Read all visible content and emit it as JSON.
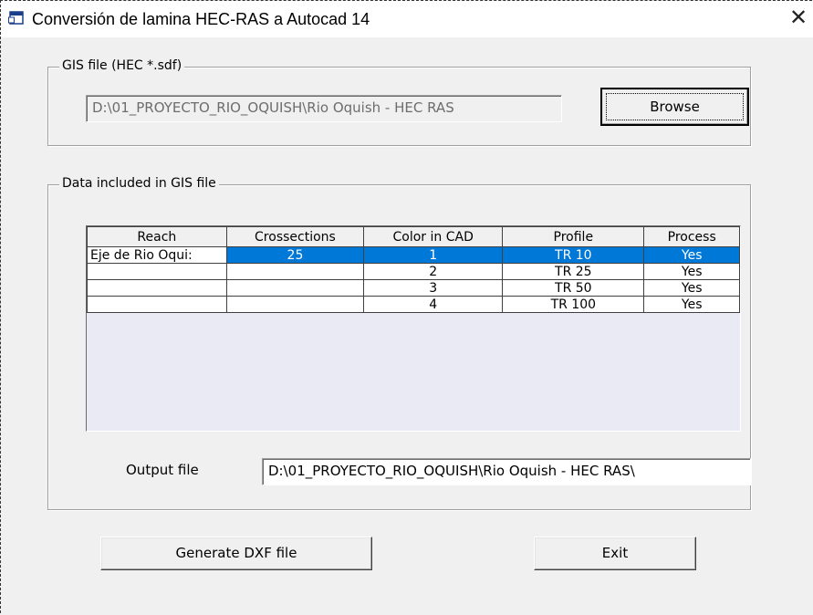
{
  "window": {
    "title": "Conversión de lamina HEC-RAS a Autocad 14",
    "close_glyph": "✕"
  },
  "gis_group": {
    "legend": "GIS file (HEC *.sdf)",
    "path_value": "D:\\01_PROYECTO_RIO_OQUISH\\Rio Oquish - HEC RAS",
    "browse_label": "Browse"
  },
  "data_group": {
    "legend": "Data included in GIS file",
    "columns": [
      "Reach",
      "Crossections",
      "Color in CAD",
      "Profile",
      "Process"
    ],
    "rows": [
      {
        "reach": "Eje de Rio Oqui:",
        "crossections": "25",
        "color": "1",
        "profile": "TR 10",
        "process": "Yes"
      },
      {
        "reach": "",
        "crossections": "",
        "color": "2",
        "profile": "TR 25",
        "process": "Yes"
      },
      {
        "reach": "",
        "crossections": "",
        "color": "3",
        "profile": "TR 50",
        "process": "Yes"
      },
      {
        "reach": "",
        "crossections": "",
        "color": "4",
        "profile": "TR 100",
        "process": "Yes"
      }
    ],
    "output_label": "Output file",
    "output_value": "D:\\01_PROYECTO_RIO_OQUISH\\Rio Oquish - HEC RAS\\"
  },
  "buttons": {
    "generate_label": "Generate DXF file",
    "exit_label": "Exit"
  },
  "colors": {
    "selection": "#0078d7",
    "grid_background": "#eaeaf4"
  }
}
